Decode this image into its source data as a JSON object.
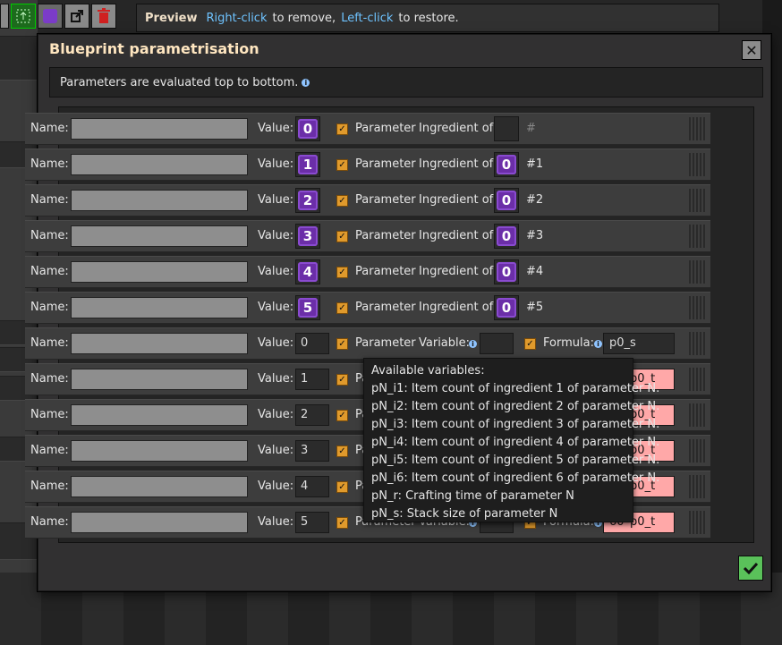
{
  "toolbar": {
    "buttons": [
      {
        "name": "select-blueprint-icon"
      },
      {
        "name": "signal-icon"
      },
      {
        "name": "export-icon"
      },
      {
        "name": "trash-icon"
      }
    ]
  },
  "preview": {
    "title": "Preview",
    "right_click": "Right-click",
    "remove_text": "to remove,",
    "left_click": "Left-click",
    "restore_text": "to restore."
  },
  "dialog": {
    "title": "Blueprint parametrisation",
    "close_icon": "close-icon",
    "info_text": "Parameters are evaluated top to bottom.",
    "confirm_icon": "checkmark-icon"
  },
  "labels": {
    "name": "Name:",
    "value": "Value:",
    "parameter": "Parameter",
    "ingredient_of": "Ingredient of:",
    "variable": "Variable:",
    "formula": "Formula:"
  },
  "item_rows": [
    {
      "signal": "0",
      "ingredient_signal": "",
      "ingredient_ref": "#"
    },
    {
      "signal": "1",
      "ingredient_signal": "0",
      "ingredient_ref": "#1"
    },
    {
      "signal": "2",
      "ingredient_signal": "0",
      "ingredient_ref": "#2"
    },
    {
      "signal": "3",
      "ingredient_signal": "0",
      "ingredient_ref": "#3"
    },
    {
      "signal": "4",
      "ingredient_signal": "0",
      "ingredient_ref": "#4"
    },
    {
      "signal": "5",
      "ingredient_signal": "0",
      "ingredient_ref": "#5"
    }
  ],
  "number_rows": [
    {
      "value": "0",
      "formula": "p0_s",
      "formula_error": false
    },
    {
      "value": "1",
      "formula": "60*p0_t",
      "formula_error": true
    },
    {
      "value": "2",
      "formula": "60*p0_t",
      "formula_error": true
    },
    {
      "value": "3",
      "formula": "60*p0_t",
      "formula_error": true
    },
    {
      "value": "4",
      "formula": "60*p0_t",
      "formula_error": true
    },
    {
      "value": "5",
      "formula": "60*p0_t",
      "formula_error": true
    }
  ],
  "tooltip": {
    "lines": [
      "Available variables:",
      "pN_i1: Item count of ingredient 1 of parameter N.",
      "pN_i2: Item count of ingredient 2 of parameter N.",
      "pN_i3: Item count of ingredient 3 of parameter N.",
      "pN_i4: Item count of ingredient 4 of parameter N.",
      "pN_i5: Item count of ingredient 5 of parameter N.",
      "pN_i6: Item count of ingredient 6 of parameter N.",
      "pN_r: Crafting time of parameter N",
      "pN_s: Stack size of parameter N"
    ]
  },
  "colors": {
    "accent_title": "#ffe6c0",
    "link_blue": "#6ec3ff",
    "signal_purple": "#6b2ea8",
    "checkbox_orange": "#e09a2c",
    "formula_error_bg": "#ffa8a8",
    "confirm_green": "#5ac15a"
  }
}
